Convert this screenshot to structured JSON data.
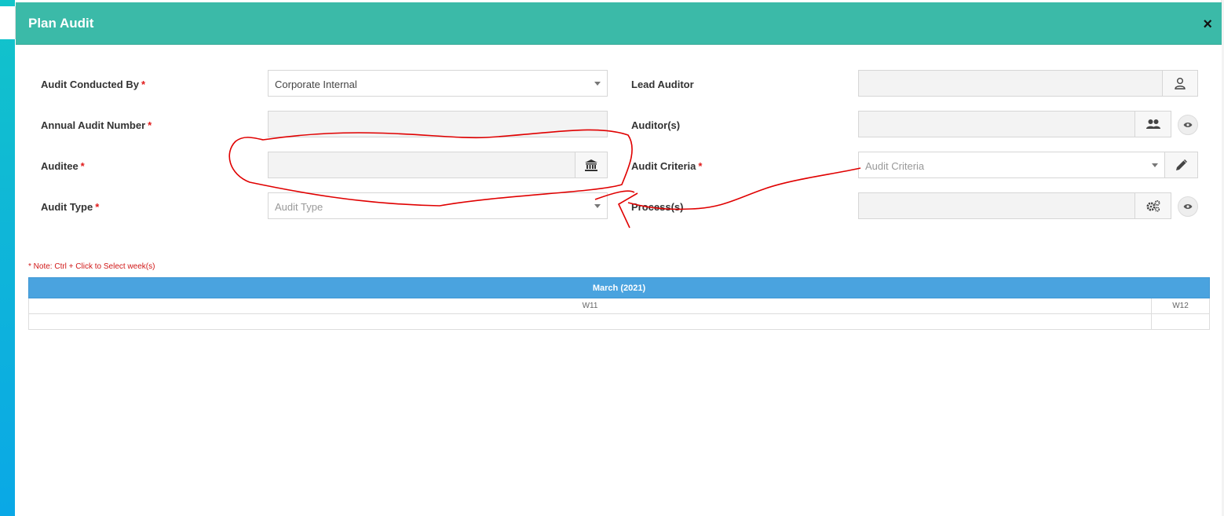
{
  "dialog": {
    "title": "Plan Audit",
    "close_symbol": "×"
  },
  "form": {
    "audit_conducted_by": {
      "label": "Audit Conducted By",
      "required_mark": "*",
      "value": "Corporate Internal"
    },
    "annual_audit_number": {
      "label": "Annual Audit Number",
      "required_mark": "*",
      "value": ""
    },
    "auditee": {
      "label": "Auditee",
      "required_mark": "*",
      "value": "",
      "icon": "building-icon"
    },
    "audit_type": {
      "label": "Audit Type",
      "required_mark": "*",
      "placeholder": "Audit Type"
    },
    "lead_auditor": {
      "label": "Lead Auditor",
      "value": "",
      "icon": "user-icon"
    },
    "auditors": {
      "label": "Auditor(s)",
      "value": "",
      "icon": "users-icon",
      "view_icon": "eye-icon"
    },
    "audit_criteria": {
      "label": "Audit Criteria",
      "required_mark": "*",
      "placeholder": "Audit Criteria",
      "icon": "pencil-icon"
    },
    "processes": {
      "label": "Process(s)",
      "value": "",
      "icon": "gears-icon",
      "view_icon": "eye-icon"
    }
  },
  "note": "* Note: Ctrl + Click to Select week(s)",
  "calendar": {
    "month_label": "March (2021)",
    "weeks": [
      "W11",
      "W12"
    ]
  },
  "colors": {
    "header": "#3bbaa8",
    "calendar_header": "#4aa3df",
    "required": "#e01a1a",
    "annotation": "#e00000"
  }
}
